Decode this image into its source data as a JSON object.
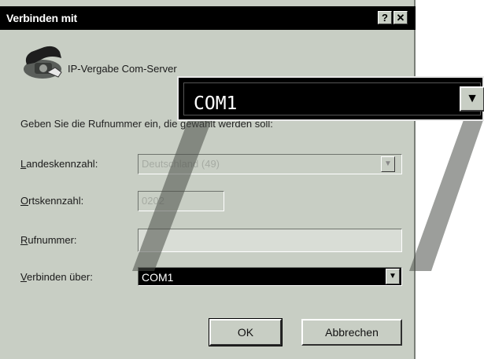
{
  "window": {
    "title": "Verbinden mit",
    "help_label": "?",
    "close_label": "✕"
  },
  "entry": {
    "name": "IP-Vergabe Com-Server",
    "icon": "telephone-icon"
  },
  "instruction": "Geben Sie die Rufnummer ein, die gewählt werden soll:",
  "fields": {
    "country": {
      "label_accel": "L",
      "label_rest": "andeskennzahl:",
      "value": "Deutschland (49)"
    },
    "area": {
      "label_accel": "O",
      "label_rest": "rtskennzahl:",
      "value": "0202"
    },
    "phone": {
      "label_accel": "R",
      "label_rest": "ufnummer:",
      "value": ""
    },
    "connect_via": {
      "label_accel": "V",
      "label_rest": "erbinden über:",
      "value": "COM1"
    }
  },
  "buttons": {
    "ok": "OK",
    "cancel": "Abbrechen"
  },
  "zoom": {
    "value": "COM1",
    "arrow": "▼"
  },
  "colors": {
    "dialog_bg": "#c8cec4",
    "titlebar": "#000000",
    "selection": "#000000"
  }
}
